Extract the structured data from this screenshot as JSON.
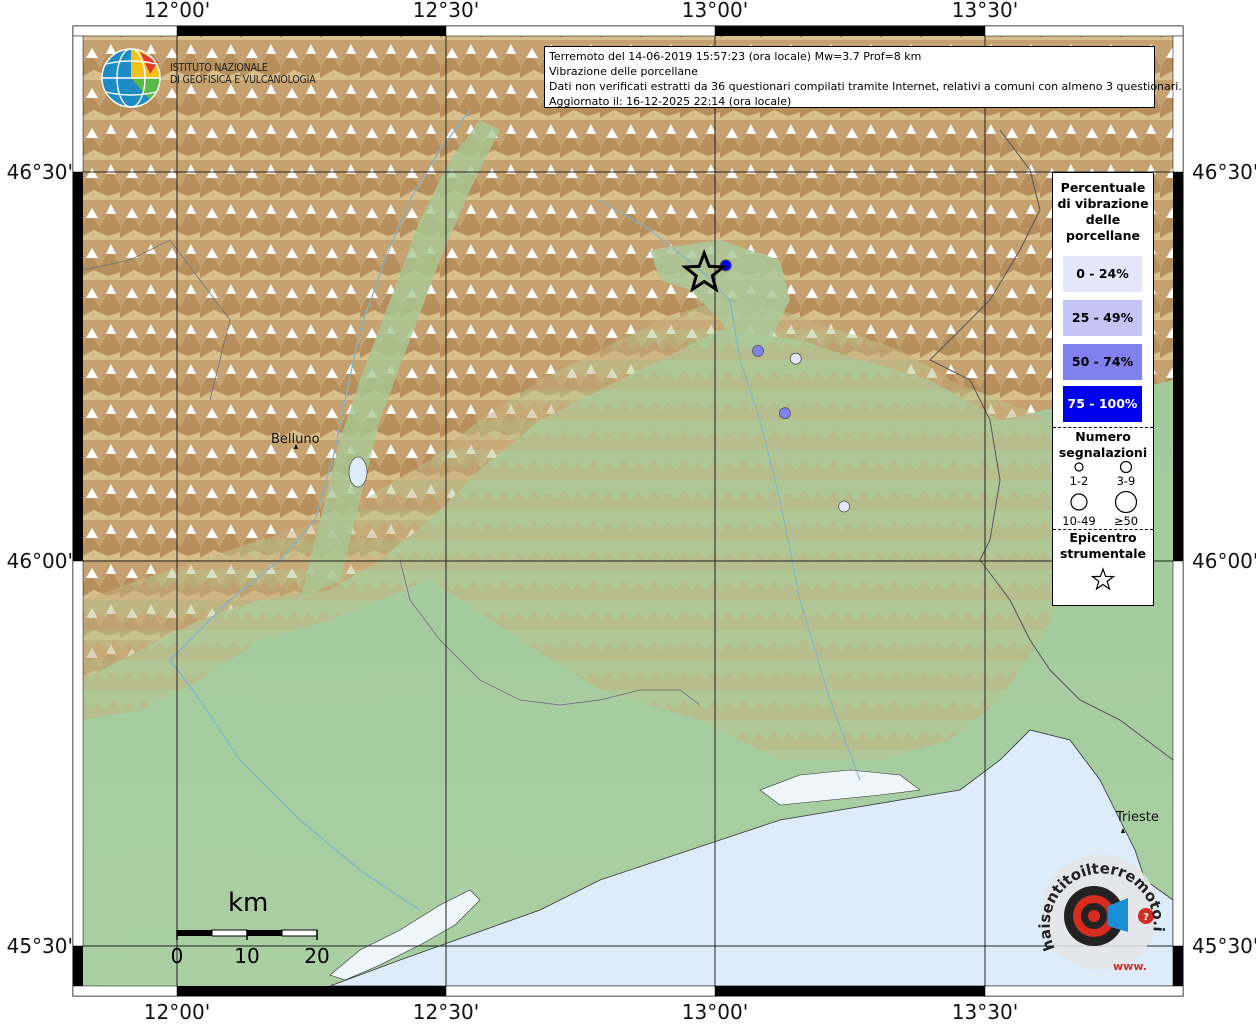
{
  "header": {
    "line1": "Terremoto del 14-06-2019 15:57:23 (ora locale) Mw=3.7 Prof=8 km",
    "line2": "Vibrazione delle porcellane",
    "line3": "Dati non verificati estratti da 36 questionari compilati tramite Internet, relativi a comuni con almeno 3 questionari.",
    "line4": "Aggiornato il: 16-12-2025 22:14 (ora locale)"
  },
  "logo": {
    "line1": "ISTITUTO NAZIONALE",
    "line2": "DI GEOFISICA E VULCANOLOGIA"
  },
  "axes": {
    "lon_labels": [
      "12°00'",
      "12°30'",
      "13°00'",
      "13°30'"
    ],
    "lat_labels": [
      "46°30'",
      "46°00'",
      "45°30'"
    ]
  },
  "places": {
    "belluno": "Belluno",
    "trieste": "Trieste"
  },
  "legend": {
    "title": "Percentuale di vibrazione delle porcellane",
    "classes": [
      {
        "label": "0 - 24%",
        "color": "#e6e6fa"
      },
      {
        "label": "25 - 49%",
        "color": "#c4c4f7"
      },
      {
        "label": "50 - 74%",
        "color": "#8080ee"
      },
      {
        "label": "75 - 100%",
        "color": "#0000ee"
      }
    ],
    "count_title": "Numero segnalazioni",
    "count_classes": [
      "1-2",
      "3-9",
      "10-49",
      "≥50"
    ],
    "epicenter_title": "Epicentro strumentale"
  },
  "scale": {
    "unit": "km",
    "ticks": [
      "0",
      "10",
      "20"
    ]
  },
  "watermark": {
    "text": "haisentitoilterremoto.it",
    "sub": "www."
  },
  "colors": {
    "sea": "#dcecfa",
    "plain": "#a8cfa0",
    "mountain": "#c9a774",
    "snow": "#ffffff",
    "grid": "#222222"
  },
  "chart_data": {
    "type": "scatter",
    "epicenter": {
      "lon": 12.98,
      "lat": 46.37
    },
    "points": [
      {
        "lon": 13.02,
        "lat": 46.38,
        "pct_class": "75 - 100%"
      },
      {
        "lon": 13.08,
        "lat": 46.27,
        "pct_class": "50 - 74%"
      },
      {
        "lon": 13.15,
        "lat": 46.26,
        "pct_class": "0 - 24%"
      },
      {
        "lon": 13.13,
        "lat": 46.19,
        "pct_class": "50 - 74%"
      },
      {
        "lon": 13.24,
        "lat": 46.07,
        "pct_class": "0 - 24%"
      }
    ],
    "lon_range": [
      11.83,
      13.86
    ],
    "lat_range": [
      45.42,
      46.68
    ]
  }
}
